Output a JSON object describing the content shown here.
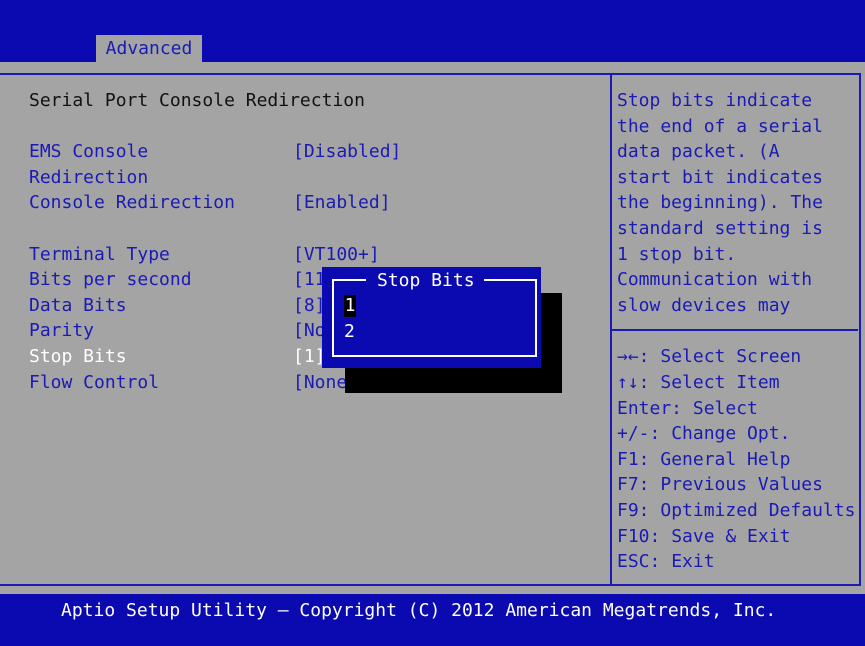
{
  "tabs": {
    "active": "Advanced"
  },
  "page": {
    "title": "Serial Port Console Redirection"
  },
  "settings": [
    {
      "label_line1": "EMS Console",
      "label_line2": "Redirection",
      "value": "[Disabled]"
    },
    {
      "label": "Console Redirection",
      "value": "[Enabled]"
    },
    {
      "label": "Terminal Type",
      "value": "[VT100+]"
    },
    {
      "label": "Bits per second",
      "value": "[11"
    },
    {
      "label": "Data Bits",
      "value": "[8]"
    },
    {
      "label": "Parity",
      "value": "[No"
    },
    {
      "label": "Stop Bits",
      "value": "[1]"
    },
    {
      "label": "Flow Control",
      "value": "[None"
    }
  ],
  "help_text": [
    "Stop bits indicate",
    "the end of a serial",
    "data packet. (A",
    "start bit indicates",
    "the beginning). The",
    "standard setting is",
    "1 stop bit.",
    "Communication with",
    "slow devices may"
  ],
  "key_help": [
    {
      "key": "→←:",
      "action": "Select Screen"
    },
    {
      "key": "↑↓:",
      "action": "Select Item"
    },
    {
      "key": "Enter:",
      "action": "Select"
    },
    {
      "key": "+/-:",
      "action": "Change Opt."
    },
    {
      "key": "F1:",
      "action": "General Help"
    },
    {
      "key": "F7:",
      "action": "Previous Values"
    },
    {
      "key": "F9:",
      "action": "Optimized Defaults"
    },
    {
      "key": "F10:",
      "action": "Save & Exit"
    },
    {
      "key": "ESC:",
      "action": "Exit"
    }
  ],
  "popup": {
    "title": "Stop Bits",
    "options": [
      "1",
      "2"
    ],
    "selected": "1"
  },
  "footer": "Aptio Setup Utility – Copyright (C) 2012 American Megatrends, Inc.",
  "colors": {
    "background": "#a4a4a4",
    "bar": "#0a0ab0",
    "text_blue": "#1a1ab4",
    "highlight": "#ffffff"
  }
}
